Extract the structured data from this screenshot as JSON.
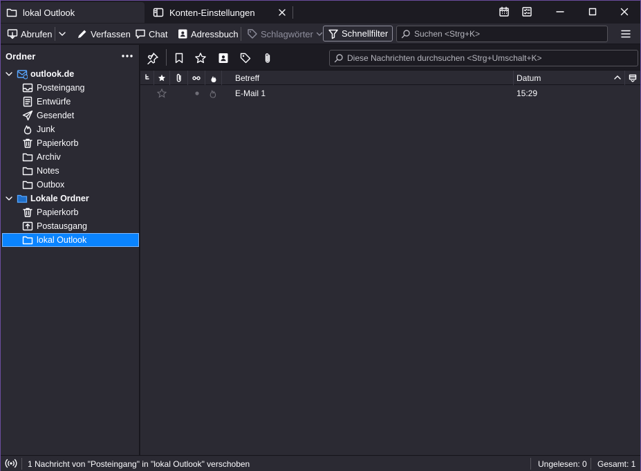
{
  "tabs": [
    {
      "label": "lokal Outlook",
      "active": true
    },
    {
      "label": "Konten-Einstellungen",
      "active": false
    }
  ],
  "toolbar": {
    "get_messages": "Abrufen",
    "compose": "Verfassen",
    "chat": "Chat",
    "address_book": "Adressbuch",
    "tags": "Schlagwörter",
    "quick_filter": "Schnellfilter",
    "search_placeholder": "Suchen <Strg+K>"
  },
  "sidebar": {
    "title": "Ordner",
    "folders": [
      {
        "label": "outlook.de",
        "icon": "mail-account-icon",
        "account": true
      },
      {
        "label": "Posteingang",
        "icon": "inbox-icon"
      },
      {
        "label": "Entwürfe",
        "icon": "drafts-icon"
      },
      {
        "label": "Gesendet",
        "icon": "sent-icon"
      },
      {
        "label": "Junk",
        "icon": "junk-icon"
      },
      {
        "label": "Papierkorb",
        "icon": "trash-icon"
      },
      {
        "label": "Archiv",
        "icon": "folder-icon"
      },
      {
        "label": "Notes",
        "icon": "folder-icon"
      },
      {
        "label": "Outbox",
        "icon": "folder-icon"
      },
      {
        "label": "Lokale Ordner",
        "icon": "local-folders-icon",
        "account": true
      },
      {
        "label": "Papierkorb",
        "icon": "trash-icon"
      },
      {
        "label": "Postausgang",
        "icon": "outbox-icon"
      },
      {
        "label": "lokal Outlook",
        "icon": "folder-icon",
        "selected": true
      }
    ]
  },
  "message_list": {
    "search_placeholder": "Diese Nachrichten durchsuchen <Strg+Umschalt+K>",
    "columns": {
      "subject": "Betreff",
      "date": "Datum"
    },
    "rows": [
      {
        "subject": "E-Mail 1",
        "date": "15:29",
        "starred": false,
        "read": true
      }
    ]
  },
  "status": {
    "message": "1 Nachricht von \"Posteingang\" in \"lokal Outlook\" verschoben",
    "unread": "Ungelesen: 0",
    "total": "Gesamt: 1"
  },
  "colors": {
    "accent": "#0a84ff",
    "window_border": "#6b4d9e",
    "background": "#1c1b22",
    "panel": "#2b2a33"
  }
}
